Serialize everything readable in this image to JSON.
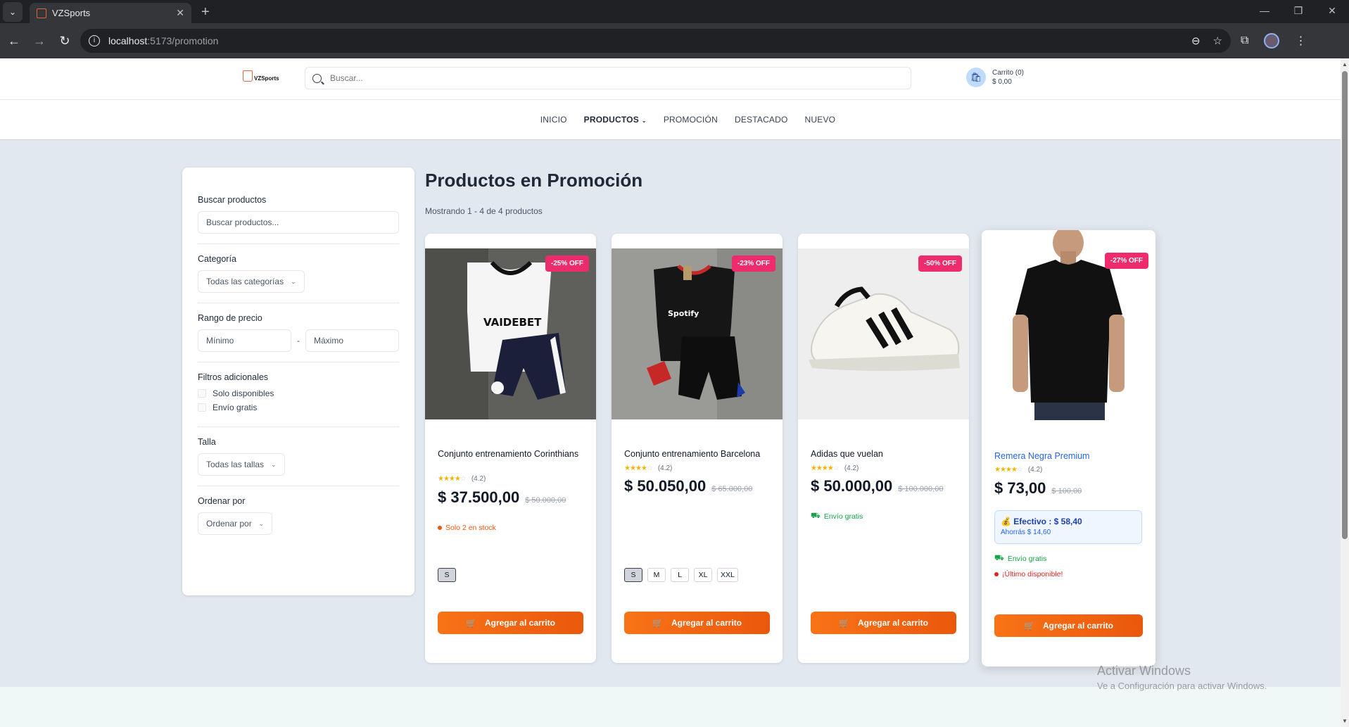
{
  "browser": {
    "tab_title": "VZSports",
    "tab_close": "✕",
    "new_tab": "+",
    "url_host": "localhost",
    "url_path": ":5173/promotion"
  },
  "header": {
    "logo_text": "VZSports",
    "search_placeholder": "Buscar...",
    "cart_label": "Carrito (0)",
    "cart_total": "$ 0,00"
  },
  "nav": {
    "items": [
      "INICIO",
      "PRODUCTOS",
      "PROMOCIÓN",
      "DESTACADO",
      "NUEVO"
    ]
  },
  "filters": {
    "search_label": "Buscar productos",
    "search_placeholder": "Buscar productos...",
    "category_label": "Categoría",
    "category_value": "Todas las categorías",
    "price_label": "Rango de precio",
    "price_min_placeholder": "Mínimo",
    "price_max_placeholder": "Máximo",
    "extra_label": "Filtros adicionales",
    "extra_options": [
      "Solo disponibles",
      "Envío gratis"
    ],
    "size_label": "Talla",
    "size_value": "Todas las tallas",
    "order_label": "Ordenar por",
    "order_value": "Ordenar por"
  },
  "main": {
    "title": "Productos en Promoción",
    "showing": "Mostrando 1 - 4 de 4 productos"
  },
  "products": [
    {
      "name": "Conjunto entrenamiento Corinthians",
      "discount": "-25% OFF",
      "rating": "(4.2)",
      "price": "$ 37.500,00",
      "old_price": "$ 50.000,00",
      "stock": "Solo 2 en stock",
      "sizes": [
        "S"
      ],
      "button": "Agregar al carrito"
    },
    {
      "name": "Conjunto entrenamiento Barcelona",
      "discount": "-23% OFF",
      "rating": "(4.2)",
      "price": "$ 50.050,00",
      "old_price": "$ 65.000,00",
      "sizes": [
        "S",
        "M",
        "L",
        "XL",
        "XXL"
      ],
      "button": "Agregar al carrito"
    },
    {
      "name": "Adidas que vuelan",
      "discount": "-50% OFF",
      "rating": "(4.2)",
      "price": "$ 50.000,00",
      "old_price": "$ 100.000,00",
      "shipping": "Envío gratis",
      "button": "Agregar al carrito"
    },
    {
      "name": "Remera Negra Premium",
      "discount": "-27% OFF",
      "rating": "(4.2)",
      "price": "$ 73,00",
      "old_price": "$ 100,00",
      "cash_price": "Efectivo : $ 58,40",
      "cash_savings": "Ahorrás $ 14,60",
      "shipping": "Envío gratis",
      "stock": "¡Último disponible!",
      "button": "Agregar al carrito"
    }
  ],
  "watermark": {
    "line1": "Activar Windows",
    "line2": "Ve a Configuración para activar Windows."
  },
  "colors": {
    "accent": "#f97316",
    "badge": "#ee2b6c",
    "link": "#2563eb",
    "success": "#16a34a",
    "danger": "#dc2626"
  }
}
